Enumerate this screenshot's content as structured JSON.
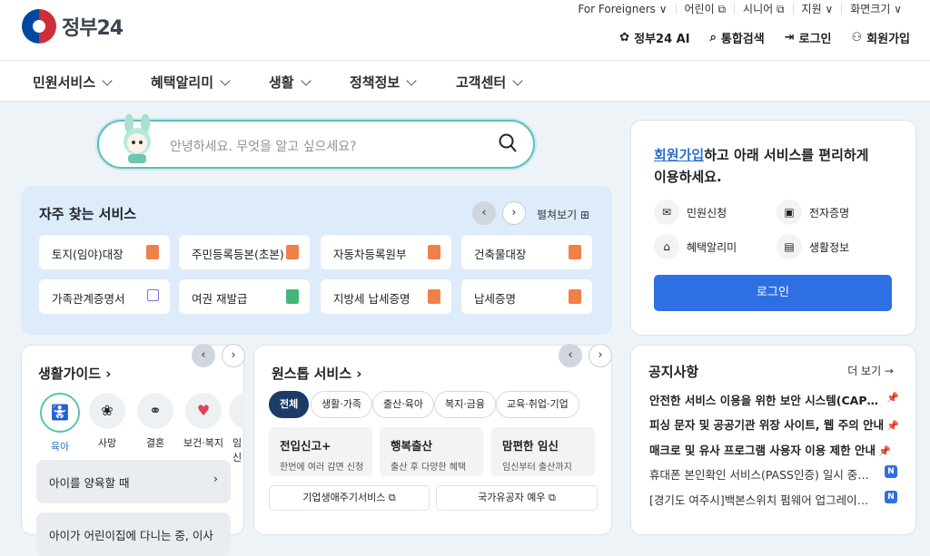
{
  "logo": {
    "text": "정부24"
  },
  "util": [
    "For Foreigners ∨",
    "어린이 ⧉",
    "시니어 ⧉",
    "지원 ∨",
    "화면크기 ∨"
  ],
  "actions": [
    {
      "icon": "ai-icon",
      "label": "정부24 AI"
    },
    {
      "icon": "search-icon",
      "label": "통합검색"
    },
    {
      "icon": "login-icon",
      "label": "로그인"
    },
    {
      "icon": "signup-icon",
      "label": "회원가입"
    }
  ],
  "gnb": [
    "민원서비스",
    "혜택알리미",
    "생활",
    "정책정보",
    "고객센터"
  ],
  "search": {
    "placeholder": "안녕하세요. 무엇을 알고 싶으세요?"
  },
  "frequent": {
    "title": "자주 찾는 서비스",
    "spread": "펼쳐보기 ⊞",
    "items": [
      "토지(임야)대장",
      "주민등록등본(초본)",
      "자동차등록원부",
      "건축물대장",
      "가족관계증명서",
      "여권 재발급",
      "지방세 납세증명",
      "납세증명"
    ]
  },
  "login": {
    "msg_link": "회원가입",
    "msg_rest": "하고 아래 서비스를 편리하게 이용하세요.",
    "items": [
      "민원신청",
      "전자증명",
      "혜택알리미",
      "생활정보"
    ],
    "button": "로그인"
  },
  "guide": {
    "title": "생활가이드 ›",
    "items": [
      "육아",
      "사망",
      "결혼",
      "보건·복지",
      "임신"
    ],
    "boxes": [
      "아이를 양육할 때",
      "아이가 어린이집에 다니는 중, 이사"
    ]
  },
  "ones": {
    "title": "원스톱 서비스 ›",
    "chips": [
      "전체",
      "생활·가족",
      "출산·육아",
      "복지·금융",
      "교육·취업·기업"
    ],
    "cards": [
      {
        "t": "전입신고+",
        "s": "한번에 여러 감면 신청"
      },
      {
        "t": "행복출산",
        "s": "출산 후 다양한 혜택"
      },
      {
        "t": "맘편한 임신",
        "s": "임신부터 출산까지"
      }
    ],
    "links": [
      "기업생애주기서비스 ⧉",
      "국가유공자 예우 ⧉"
    ]
  },
  "notice": {
    "title": "공지사항",
    "more": "더 보기 →",
    "rows": [
      "안전한 서비스 이용을 위한 보안 시스템(CAPTCHA) 도입",
      "피싱 문자 및 공공기관 위장 사이트, 웹 주의 안내",
      "매크로 및 유사 프로그램 사용자 이용 제한 안내",
      "휴대폰 본인확인 서비스(PASS인증) 일시 중단 안내",
      "[경기도 여주시]백본스위치 펌웨어 업그레이드 작업 안내"
    ],
    "badge": "N"
  }
}
